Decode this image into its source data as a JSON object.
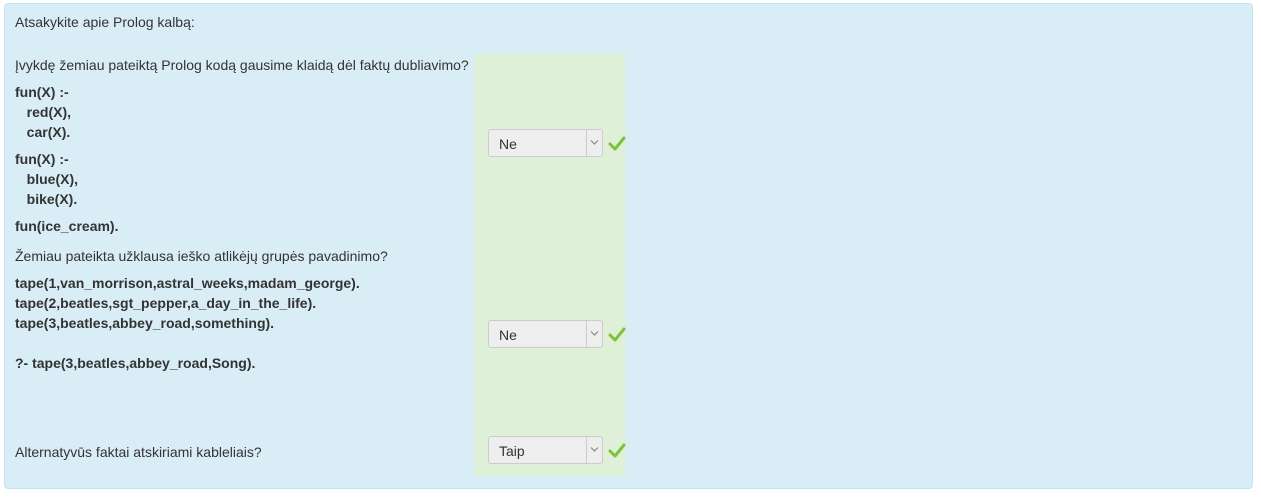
{
  "intro": "Atsakykite apie Prolog kalbą:",
  "questions": [
    {
      "text": "Įvykdę žemiau pateiktą Prolog kodą gausime klaidą dėl faktų dubliavimo?",
      "code": [
        "fun(X) :-\n   red(X),\n   car(X).",
        "fun(X) :-\n   blue(X),\n   bike(X).",
        "fun(ice_cream)."
      ],
      "answer": "Ne",
      "status_icon": "checkmark-icon"
    },
    {
      "text": "Žemiau pateikta užklausa ieško atlikėjų grupės pavadinimo?",
      "code": [
        "tape(1,van_morrison,astral_weeks,madam_george).\ntape(2,beatles,sgt_pepper,a_day_in_the_life).\ntape(3,beatles,abbey_road,something).",
        "?- tape(3,beatles,abbey_road,Song)."
      ],
      "answer": "Ne",
      "status_icon": "checkmark-icon"
    },
    {
      "text": "Alternatyvūs faktai atskiriami kableliais?",
      "answer": "Taip",
      "status_icon": "checkmark-icon"
    }
  ],
  "colors": {
    "panel_bg": "#d9edf7",
    "answer_bg": "#dff0d8",
    "check": "#7cc23a"
  }
}
